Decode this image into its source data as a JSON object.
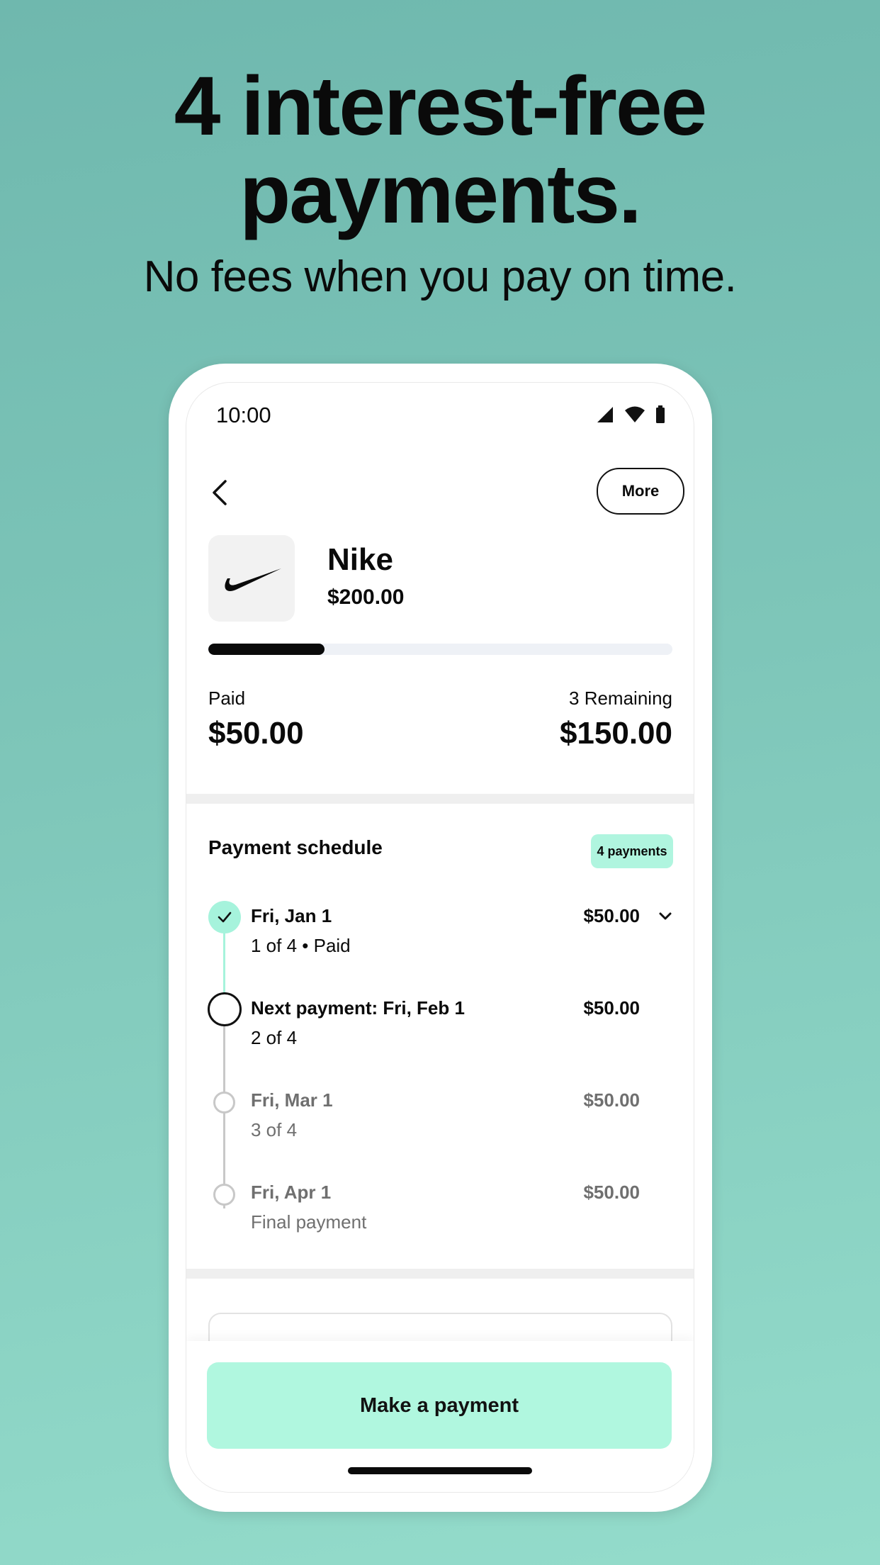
{
  "promo": {
    "headline_line1": "4 interest-free",
    "headline_line2": "payments.",
    "subline": "No fees when you pay on time."
  },
  "status_bar": {
    "time": "10:00",
    "icons": [
      "signal-icon",
      "wifi-icon",
      "battery-icon"
    ]
  },
  "header": {
    "back_icon": "chevron-left-icon",
    "more_label": "More"
  },
  "merchant": {
    "logo": "nike-swoosh-logo",
    "name": "Nike",
    "amount": "$200.00"
  },
  "progress": {
    "paid_fraction": 0.25
  },
  "summary": {
    "paid_label": "Paid",
    "paid_value": "$50.00",
    "remaining_label": "3 Remaining",
    "remaining_value": "$150.00"
  },
  "schedule": {
    "title": "Payment schedule",
    "badge": "4 payments",
    "items": [
      {
        "date": "Fri, Jan 1",
        "sub": "1 of 4 • Paid",
        "amount": "$50.00",
        "state": "paid"
      },
      {
        "date": "Next payment: Fri, Feb 1",
        "sub": "2 of 4",
        "amount": "$50.00",
        "state": "next"
      },
      {
        "date": "Fri, Mar 1",
        "sub": "3 of 4",
        "amount": "$50.00",
        "state": "upcoming"
      },
      {
        "date": "Fri, Apr 1",
        "sub": "Final payment",
        "amount": "$50.00",
        "state": "upcoming"
      }
    ]
  },
  "cta": {
    "label": "Make a payment"
  },
  "colors": {
    "background_top": "#6fb8ae",
    "background_bottom": "#94dccb",
    "accent_mint": "#b0f7df",
    "paid_dot": "#a6f3dc",
    "text": "#0a0a0a"
  }
}
